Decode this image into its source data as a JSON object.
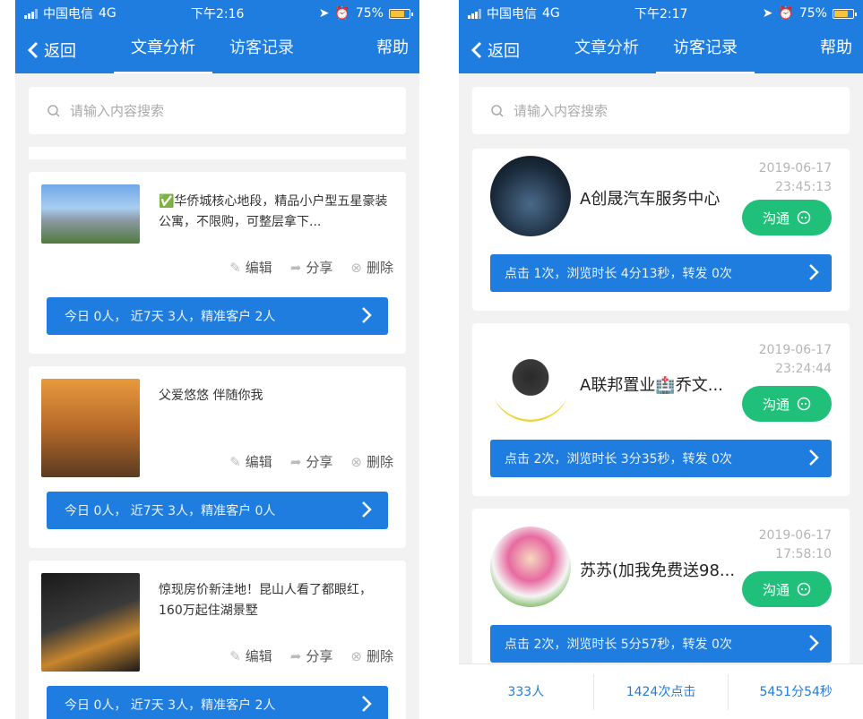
{
  "status_left": {
    "carrier": "中国电信",
    "network": "4G",
    "time": "下午2:16",
    "battery": "75%"
  },
  "status_right": {
    "carrier": "中国电信",
    "network": "4G",
    "time": "下午2:17",
    "battery": "75%"
  },
  "nav": {
    "back": "返回",
    "tab_articles": "文章分析",
    "tab_visitors": "访客记录",
    "help": "帮助"
  },
  "search": {
    "placeholder": "请输入内容搜索"
  },
  "articles": [
    {
      "title": "✅华侨城核心地段，精品小户型五星豪装公寓，不限购，可整层拿下...",
      "edit": "编辑",
      "share": "分享",
      "delete": "删除",
      "stats": "今日 0人，  近7天 3人，精准客户 2人"
    },
    {
      "title": "父爱悠悠 伴随你我",
      "edit": "编辑",
      "share": "分享",
      "delete": "删除",
      "stats": "今日 0人，  近7天 3人，精准客户 0人"
    },
    {
      "title": "惊现房价新洼地！昆山人看了都眼红，160万起住湖景墅",
      "edit": "编辑",
      "share": "分享",
      "delete": "删除",
      "stats": "今日 0人，  近7天 3人，精准客户 2人"
    }
  ],
  "visitors": [
    {
      "name": "A创晟汽车服务中心",
      "date": "2019-06-17",
      "time": "23:45:13",
      "chat": "沟通",
      "stats": "点击 1次，浏览时长 4分13秒，转发 0次"
    },
    {
      "name": "A联邦置业🏥乔文...",
      "date": "2019-06-17",
      "time": "23:24:44",
      "chat": "沟通",
      "stats": "点击 2次，浏览时长 3分35秒，转发 0次"
    },
    {
      "name": "苏苏(加我免费送98...",
      "date": "2019-06-17",
      "time": "17:58:10",
      "chat": "沟通",
      "stats": "点击 2次，浏览时长 5分57秒，转发 0次"
    }
  ],
  "summary": {
    "people": "333人",
    "clicks": "1424次点击",
    "duration": "5451分54秒"
  },
  "colors": {
    "primary": "#1f7de0",
    "chat_green": "#20c07a"
  }
}
